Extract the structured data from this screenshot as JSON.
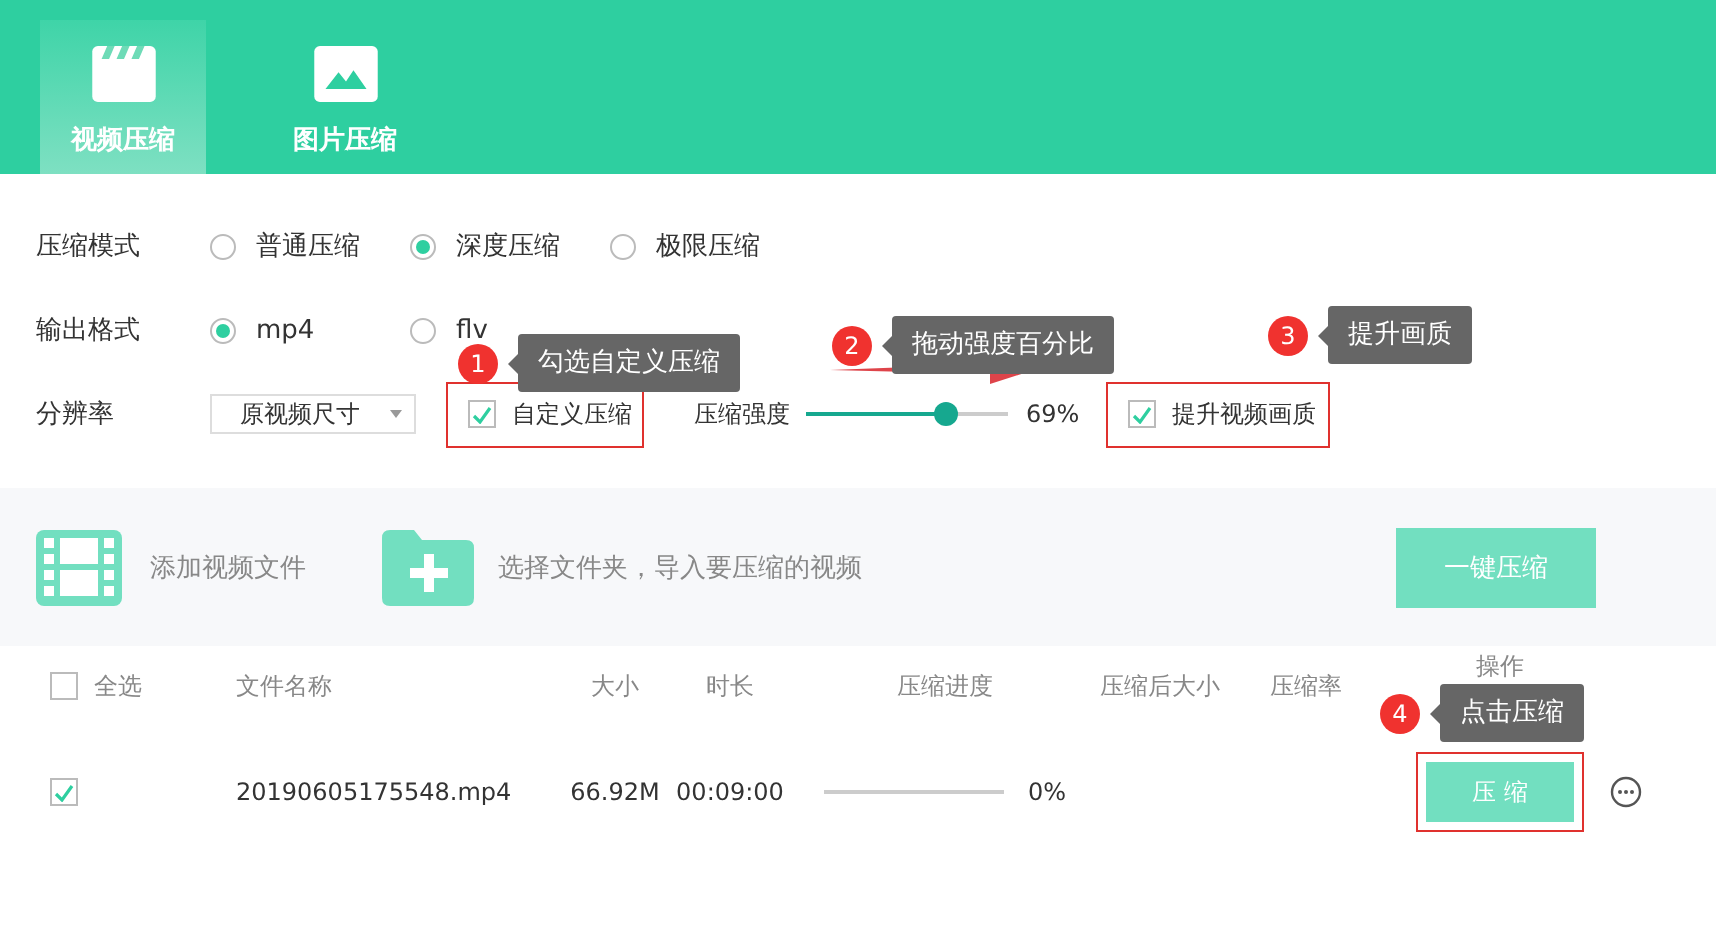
{
  "tabs": [
    {
      "label": "视频压缩",
      "selected": true
    },
    {
      "label": "图片压缩",
      "selected": false
    }
  ],
  "settings": {
    "mode": {
      "label": "压缩模式",
      "options": [
        {
          "label": "普通压缩",
          "selected": false
        },
        {
          "label": "深度压缩",
          "selected": true
        },
        {
          "label": "极限压缩",
          "selected": false
        }
      ]
    },
    "format": {
      "label": "输出格式",
      "options": [
        {
          "label": "mp4",
          "selected": true
        },
        {
          "label": "flv",
          "selected": false
        }
      ]
    },
    "resolution": {
      "label": "分辨率",
      "value": "原视频尺寸"
    },
    "custom": {
      "label": "自定义压缩",
      "checked": true,
      "highlighted": true
    },
    "strength": {
      "label": "压缩强度",
      "level": 0.69,
      "reading": "69%"
    },
    "enhance": {
      "label": "提升视频画质",
      "checked": true,
      "highlighted": true
    }
  },
  "toolbar": {
    "add_file": "添加视频文件",
    "add_folder": "选择文件夹，导入要压缩的视频",
    "compress_all": "一键压缩"
  },
  "table": {
    "select_all": {
      "label": "全选",
      "checked": false
    },
    "columns": [
      "文件名称",
      "大小",
      "时长",
      "压缩进度",
      "压缩后大小",
      "压缩率",
      "操作"
    ],
    "rows": [
      {
        "checked": true,
        "name": "20190605175548.mp4",
        "size": "66.92M",
        "duration": "00:09:00",
        "level": 0,
        "progress": "0%",
        "action": "压 缩",
        "highlighted": true
      }
    ]
  },
  "annotations": [
    {
      "number": "1",
      "text": "勾选自定义压缩"
    },
    {
      "number": "2",
      "text": "拖动强度百分比"
    },
    {
      "number": "3",
      "text": "提升画质"
    },
    {
      "number": "4",
      "text": "点击压缩"
    }
  ]
}
